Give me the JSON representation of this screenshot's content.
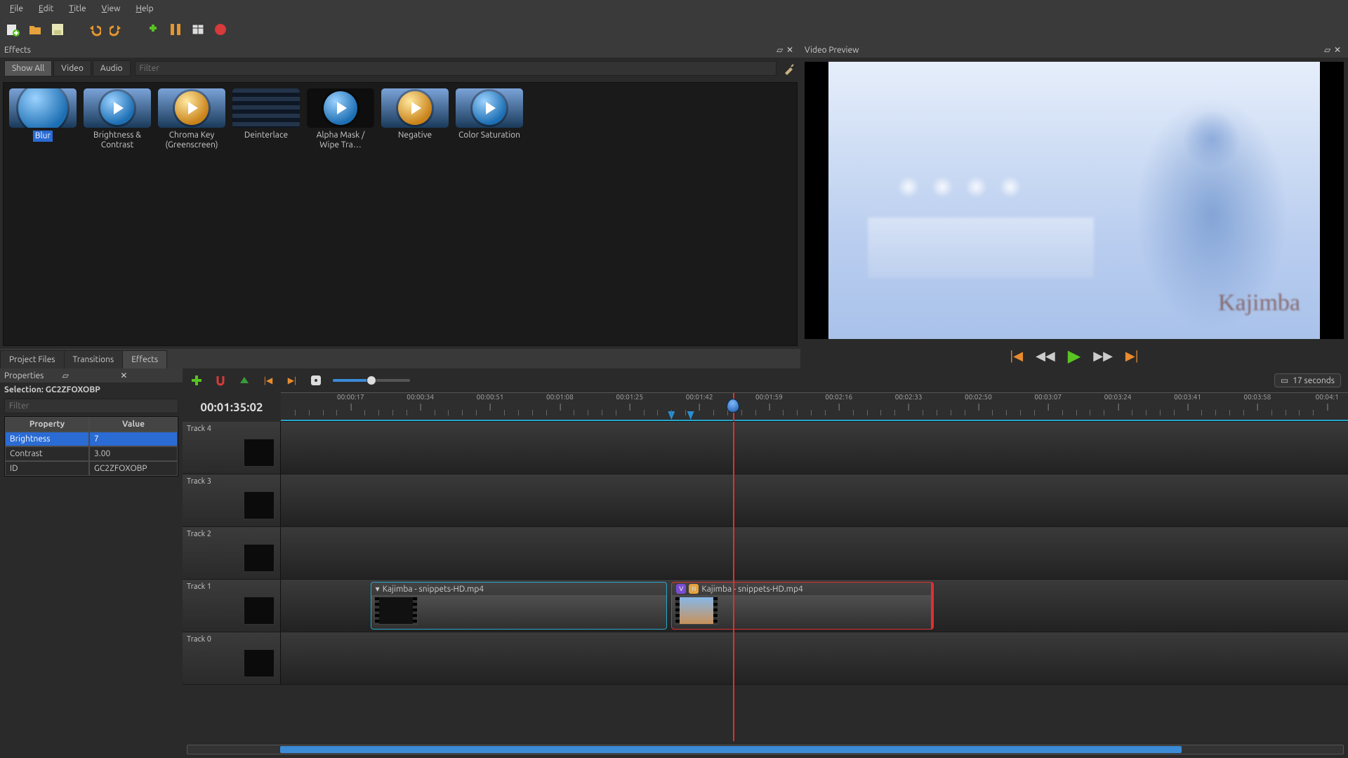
{
  "menubar": [
    "File",
    "Edit",
    "Title",
    "View",
    "Help"
  ],
  "panels": {
    "effects": "Effects",
    "preview": "Video Preview",
    "properties": "Properties"
  },
  "effects_tabs": {
    "showall": "Show All",
    "video": "Video",
    "audio": "Audio",
    "filter_ph": "Filter"
  },
  "effects": [
    {
      "label": "Blur",
      "selected": true,
      "style": "big"
    },
    {
      "label": "Brightness & Contrast",
      "style": "play"
    },
    {
      "label": "Chroma Key (Greenscreen)",
      "style": "gold"
    },
    {
      "label": "Deinterlace",
      "style": "stripes"
    },
    {
      "label": "Alpha Mask / Wipe Tra…",
      "style": "play"
    },
    {
      "label": "Negative",
      "style": "gold"
    },
    {
      "label": "Color Saturation",
      "style": "play"
    }
  ],
  "bottom_tabs": {
    "pf": "Project Files",
    "tr": "Transitions",
    "fx": "Effects"
  },
  "properties": {
    "selection_prefix": "Selection: ",
    "selection": "GC2ZFOXOBP",
    "filter_ph": "Filter",
    "headers": {
      "k": "Property",
      "v": "Value"
    },
    "rows": [
      {
        "k": "Brightness",
        "v": "7",
        "sel": true
      },
      {
        "k": "Contrast",
        "v": "3.00"
      },
      {
        "k": "ID",
        "v": "GC2ZFOXOBP"
      }
    ]
  },
  "timeline": {
    "readout": "00:01:35:02",
    "seconds_label": "17 seconds",
    "ticks": [
      "00:00:17",
      "00:00:34",
      "00:00:51",
      "00:01:08",
      "00:01:25",
      "00:01:42",
      "00:01:59",
      "00:02:16",
      "00:02:33",
      "00:02:50",
      "00:03:07",
      "00:03:24",
      "00:03:41",
      "00:03:58",
      "00:04:1"
    ],
    "tracks": [
      "Track 4",
      "Track 3",
      "Track 2",
      "Track 1",
      "Track 0"
    ],
    "clips": [
      {
        "title": "Kajimba - snippets-HD.mp4"
      },
      {
        "title": "Kajimba - snippets-HD.mp4"
      }
    ]
  }
}
